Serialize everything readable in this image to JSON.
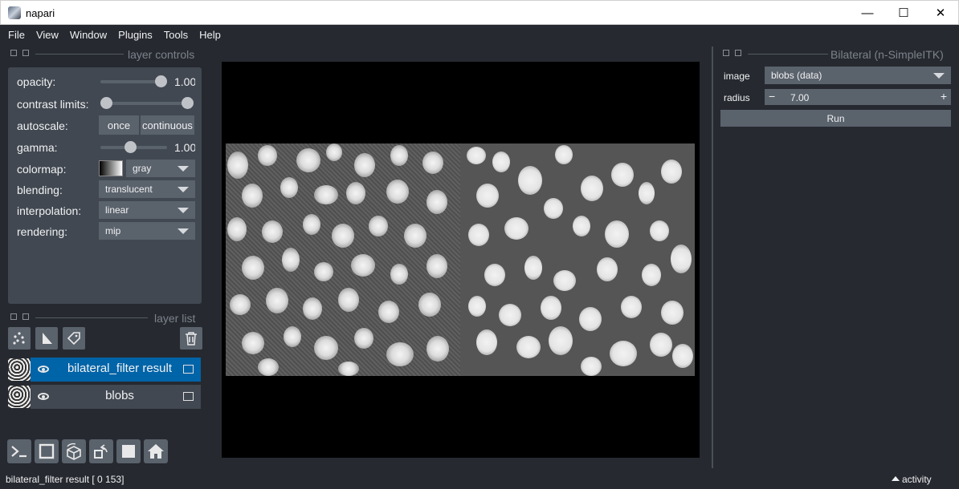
{
  "window": {
    "title": "napari",
    "minimize": "—",
    "maximize": "☐",
    "close": "✕"
  },
  "menu": [
    "File",
    "View",
    "Window",
    "Plugins",
    "Tools",
    "Help"
  ],
  "layer_controls": {
    "header": "layer controls",
    "opacity_label": "opacity:",
    "opacity_value": "1.00",
    "opacity": 1.0,
    "contrast_label": "contrast limits:",
    "autoscale_label": "autoscale:",
    "once": "once",
    "continuous": "continuous",
    "gamma_label": "gamma:",
    "gamma_value": "1.00",
    "gamma": 1.0,
    "colormap_label": "colormap:",
    "colormap": "gray",
    "blending_label": "blending:",
    "blending": "translucent",
    "interpolation_label": "interpolation:",
    "interpolation": "linear",
    "rendering_label": "rendering:",
    "rendering": "mip"
  },
  "layer_list": {
    "header": "layer list",
    "layers": [
      {
        "name": "bilateral_filter result",
        "selected": true
      },
      {
        "name": "blobs",
        "selected": false
      }
    ]
  },
  "plugin": {
    "header": "Bilateral (n-SimpleITK)",
    "image_label": "image",
    "image_value": "blobs (data)",
    "radius_label": "radius",
    "radius_value": "7.00",
    "minus": "−",
    "plus": "+",
    "run": "Run"
  },
  "status": {
    "text": "bilateral_filter result [  0 153]",
    "activity": "activity"
  },
  "colors": {
    "accent": "#0064a8",
    "bg": "#262930",
    "panel": "#414851",
    "widget": "#5a626c"
  },
  "icons": [
    "points-icon",
    "shapes-icon",
    "labels-icon",
    "trash-icon",
    "console-icon",
    "ndisplay-icon",
    "roll-icon",
    "transpose-icon",
    "grid-icon",
    "home-icon"
  ]
}
